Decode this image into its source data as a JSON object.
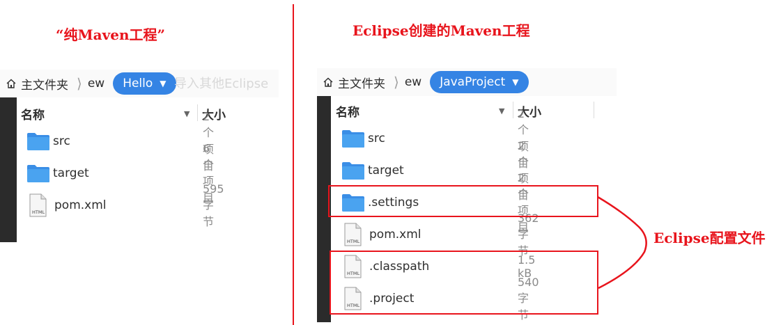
{
  "annotations": {
    "left_title": "“纯Maven工程”",
    "right_title": "Eclipse创建的Maven工程",
    "config_label": "Eclipse配置文件"
  },
  "left_window": {
    "breadcrumb": {
      "home": "主文件夹",
      "parent": "ew",
      "current": "Hello"
    },
    "background_text": "导入其他Eclipse",
    "columns": {
      "name": "名称",
      "size": "大小"
    },
    "items": [
      {
        "name": "src",
        "type": "folder",
        "size": "2 个项目"
      },
      {
        "name": "target",
        "type": "folder",
        "size": "6 个项目"
      },
      {
        "name": "pom.xml",
        "type": "html-file",
        "size": "595 字节"
      }
    ]
  },
  "right_window": {
    "breadcrumb": {
      "home": "主文件夹",
      "parent": "ew",
      "current": "JavaProject"
    },
    "columns": {
      "name": "名称",
      "size": "大小"
    },
    "items": [
      {
        "name": "src",
        "type": "folder",
        "size": "2 个项目"
      },
      {
        "name": "target",
        "type": "folder",
        "size": "2 个项目"
      },
      {
        "name": ".settings",
        "type": "folder",
        "size": "2 个项目"
      },
      {
        "name": "pom.xml",
        "type": "html-file",
        "size": "362 字节"
      },
      {
        "name": ".classpath",
        "type": "html-file",
        "size": "1.5 kB"
      },
      {
        "name": ".project",
        "type": "html-file",
        "size": "540 字节"
      }
    ]
  },
  "file_icon_label": "HTML",
  "colors": {
    "annotation_red": "#e8141c",
    "accent_blue": "#3584e4",
    "folder_blue": "#4aa3f0"
  }
}
